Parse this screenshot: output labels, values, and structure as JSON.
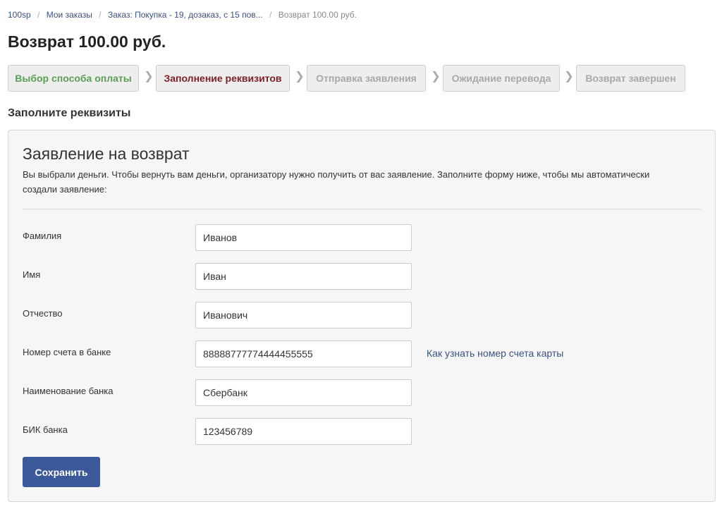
{
  "breadcrumb": {
    "items": [
      {
        "label": "100sp"
      },
      {
        "label": "Мои заказы"
      },
      {
        "label": "Заказ: Покупка - 19, дозаказ, с 15 пов..."
      }
    ],
    "current": "Возврат 100.00 руб.",
    "separator": "/"
  },
  "page_title": "Возврат 100.00 руб.",
  "steps": [
    {
      "label": "Выбор способа оплаты",
      "state": "done"
    },
    {
      "label": "Заполнение реквизитов",
      "state": "active"
    },
    {
      "label": "Отправка заявления",
      "state": "pending"
    },
    {
      "label": "Ожидание перевода",
      "state": "pending"
    },
    {
      "label": "Возврат завершен",
      "state": "pending"
    }
  ],
  "step_arrow_icon": "chevron-right-icon",
  "section_title": "Заполните реквизиты",
  "form": {
    "title": "Заявление на возврат",
    "description": "Вы выбрали деньги. Чтобы вернуть вам деньги, организатору нужно получить от вас заявление. Заполните форму ниже, чтобы мы автоматически создали заявление:",
    "fields": [
      {
        "label": "Фамилия",
        "value": "Иванов"
      },
      {
        "label": "Имя",
        "value": "Иван"
      },
      {
        "label": "Отчество",
        "value": "Иванович"
      },
      {
        "label": "Номер счета в банке",
        "value": "88888777774444455555"
      },
      {
        "label": "Наименование банка",
        "value": "Сбербанк"
      },
      {
        "label": "БИК банка",
        "value": "123456789"
      }
    ],
    "help_link": "Как узнать номер счета карты",
    "save_label": "Сохранить"
  },
  "colors": {
    "step_done": "#5c9e56",
    "step_active": "#7d1f26",
    "step_pending": "#a8a8a8",
    "link": "#3b5183",
    "button": "#3b5998"
  }
}
